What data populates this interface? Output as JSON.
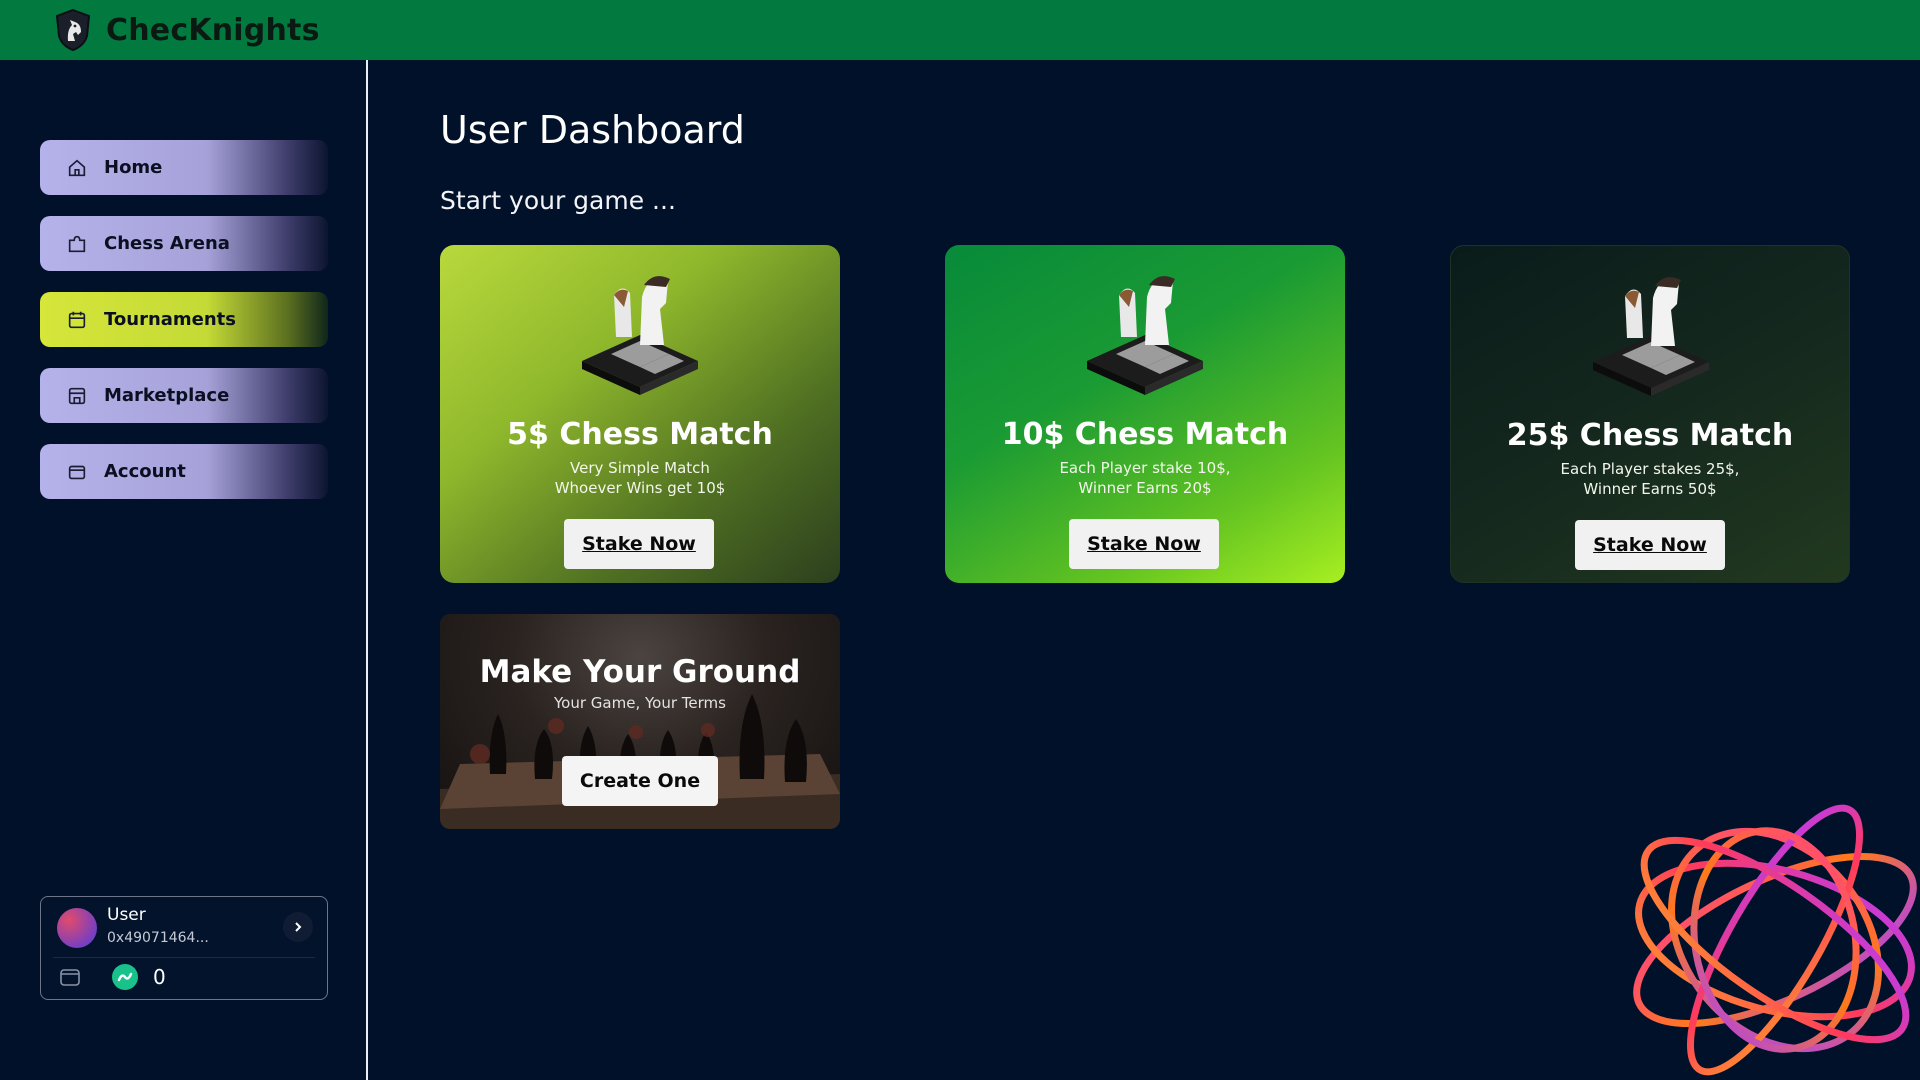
{
  "app": {
    "brand": "ChecKnights"
  },
  "sidebar": {
    "items": [
      {
        "label": "Home",
        "icon": "home-icon"
      },
      {
        "label": "Chess Arena",
        "icon": "puzzle-icon"
      },
      {
        "label": "Tournaments",
        "icon": "calendar-icon",
        "active": true
      },
      {
        "label": "Marketplace",
        "icon": "store-icon"
      },
      {
        "label": "Account",
        "icon": "wallet-icon"
      }
    ],
    "user": {
      "name": "User",
      "address": "0x49071464...",
      "balance": "0"
    }
  },
  "main": {
    "title": "User Dashboard",
    "subtitle": "Start your game ...",
    "cards": [
      {
        "title": "5$ Chess Match",
        "line1": "Very Simple Match",
        "line2": "Whoever Wins get 10$",
        "button": "Stake Now"
      },
      {
        "title": "10$ Chess Match",
        "line1": "Each Player stake 10$,",
        "line2": "Winner Earns 20$",
        "button": "Stake Now"
      },
      {
        "title": "25$ Chess Match",
        "line1": "Each Player stakes 25$,",
        "line2": "Winner Earns 50$",
        "button": "Stake Now"
      }
    ],
    "ground": {
      "title": "Make Your Ground",
      "subtitle": "Your Game, Your Terms",
      "button": "Create One"
    }
  },
  "colors": {
    "topbar": "#027a3f",
    "background": "#02112a",
    "nav": "#b5b2ea",
    "nav_active": "#d6e63a"
  }
}
